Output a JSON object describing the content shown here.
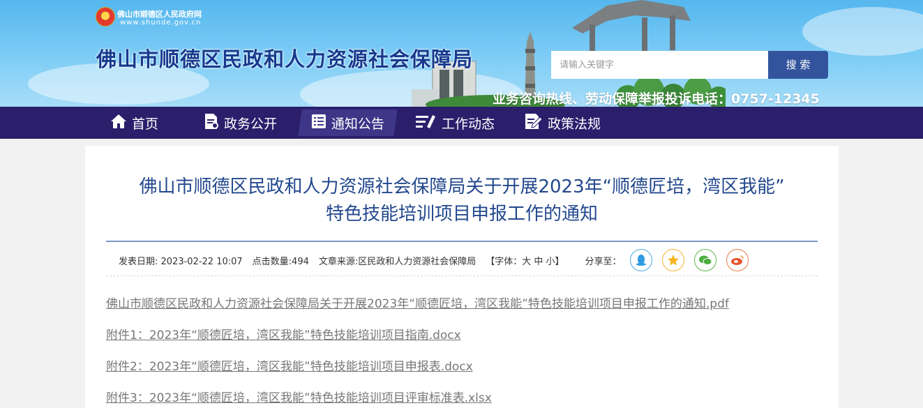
{
  "header": {
    "gov_name": "佛山市顺德区人民政府网",
    "gov_url": "www.shunde.gov.cn",
    "site_title": "佛山市顺德区民政和人力资源社会保障局",
    "search": {
      "placeholder": "请输入关键字",
      "button_label": "搜 索"
    },
    "hotline": "业务咨询热线、劳动保障举报投诉电话：0757-12345"
  },
  "nav": {
    "items": [
      {
        "label": "首页",
        "icon": "home-icon"
      },
      {
        "label": "政务公开",
        "icon": "document-icon"
      },
      {
        "label": "通知公告",
        "icon": "list-icon",
        "active": true
      },
      {
        "label": "工作动态",
        "icon": "lines-icon"
      },
      {
        "label": "政策法规",
        "icon": "edit-doc-icon"
      }
    ]
  },
  "article": {
    "title_line1": "佛山市顺德区民政和人力资源社会保障局关于开展2023年“顺德匠培，湾区我能”",
    "title_line2": "特色技能培训项目申报工作的通知",
    "meta": {
      "date": "发表日期: 2023-02-22 10:07",
      "clicks": "点击数量:494",
      "source": "文章来源:区民政和人力资源社会保障局",
      "font_size": "【字体：大 中 小】",
      "share_label": "分享至："
    },
    "share_icons": [
      "qq-icon",
      "qzone-star-icon",
      "wechat-icon",
      "weibo-icon"
    ],
    "attachments": [
      "佛山市顺德区民政和人力资源社会保障局关于开展2023年“顺德匠培，湾区我能”特色技能培训项目申报工作的通知.pdf",
      "附件1：2023年“顺德匠培，湾区我能”特色技能培训项目指南.docx",
      "附件2：2023年“顺德匠培，湾区我能”特色技能培训项目申报表.docx",
      "附件3：2023年“顺德匠培，湾区我能”特色技能培训项目评审标准表.xlsx"
    ]
  },
  "colors": {
    "nav_bg": "#2b1f6c",
    "title_blue": "#23488e",
    "search_button": "#33549d"
  }
}
